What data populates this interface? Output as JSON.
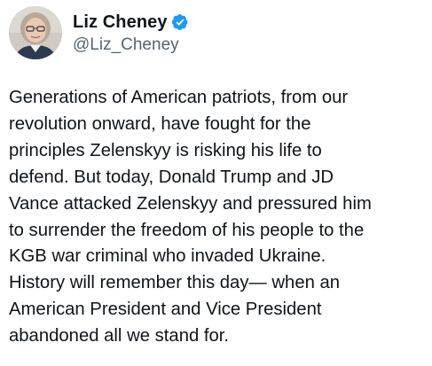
{
  "author": {
    "display_name": "Liz Cheney",
    "handle": "@Liz_Cheney",
    "verified": true,
    "verified_icon": "verified-badge-icon",
    "verified_color": "#1d9bf0"
  },
  "tweet": {
    "text": "Generations of American patriots, from our\nrevolution onward, have fought for  the\nprinciples Zelenskyy is risking his life to\ndefend. But today, Donald Trump and JD\nVance attacked Zelenskyy and pressured him\nto surrender the freedom of his people to the\nKGB war criminal who invaded Ukraine.\nHistory will remember this day— when an\nAmerican President and Vice President\nabandoned all we stand for."
  },
  "colors": {
    "text": "#0f1419",
    "secondary_text": "#536471",
    "background": "#ffffff"
  }
}
